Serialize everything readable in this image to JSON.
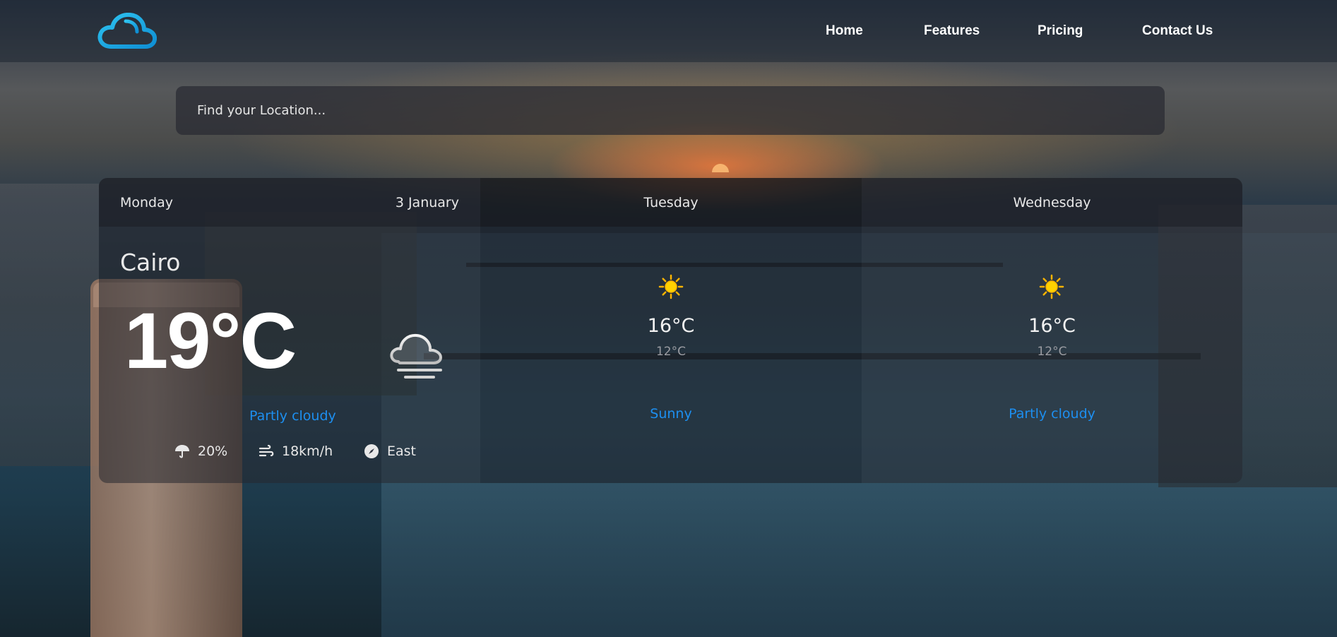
{
  "nav": {
    "logo_icon": "cloud-icon",
    "links": [
      "Home",
      "Features",
      "Pricing",
      "Contact Us"
    ]
  },
  "search": {
    "placeholder": "Find your Location..."
  },
  "today": {
    "day": "Monday",
    "date": "3 January",
    "city": "Cairo",
    "temp": "19°C",
    "icon": "cloud-icon",
    "condition": "Partly cloudy",
    "rain": "20%",
    "wind": "18km/h",
    "direction": "East"
  },
  "forecast": [
    {
      "day": "Tuesday",
      "icon": "sun-icon",
      "max": "16°C",
      "min": "12°C",
      "condition": "Sunny"
    },
    {
      "day": "Wednesday",
      "icon": "sun-icon",
      "max": "16°C",
      "min": "12°C",
      "condition": "Partly cloudy"
    }
  ],
  "colors": {
    "accent": "#1d8ff0",
    "logo": "#1aa7e8",
    "sun": "#ffd200"
  }
}
